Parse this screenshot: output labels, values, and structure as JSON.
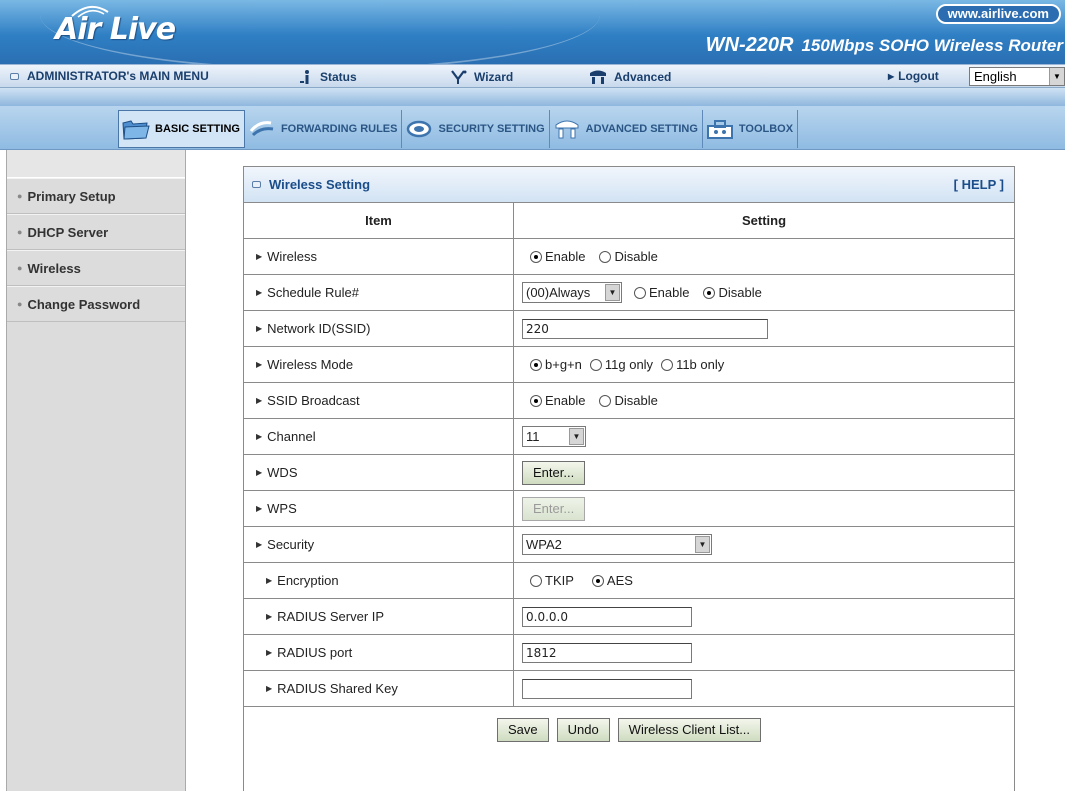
{
  "header": {
    "logo": "Air Live",
    "url": "www.airlive.com",
    "model": "WN-220R",
    "model_desc": "150Mbps SOHO Wireless Router"
  },
  "menubar": {
    "main_menu": "ADMINISTRATOR's MAIN MENU",
    "status": "Status",
    "wizard": "Wizard",
    "advanced": "Advanced",
    "logout": "Logout",
    "language": "English"
  },
  "toolbar": {
    "tabs": [
      {
        "label": "BASIC SETTING",
        "icon": "folder-icon",
        "active": true
      },
      {
        "label": "FORWARDING RULES",
        "icon": "arrows-icon",
        "active": false
      },
      {
        "label": "SECURITY SETTING",
        "icon": "security-icon",
        "active": false
      },
      {
        "label": "ADVANCED SETTING",
        "icon": "gear-icon",
        "active": false
      },
      {
        "label": "TOOLBOX",
        "icon": "toolbox-icon",
        "active": false
      }
    ]
  },
  "sidebar": {
    "items": [
      {
        "label": "Primary Setup"
      },
      {
        "label": "DHCP Server"
      },
      {
        "label": "Wireless"
      },
      {
        "label": "Change Password"
      }
    ]
  },
  "panel": {
    "title": "Wireless Setting",
    "help": "[ HELP ]",
    "col_item": "Item",
    "col_setting": "Setting",
    "rows": {
      "wireless": {
        "label": "Wireless",
        "opt1": "Enable",
        "opt2": "Disable",
        "selected": "Enable"
      },
      "schedule": {
        "label": "Schedule Rule#",
        "select": "(00)Always",
        "opt1": "Enable",
        "opt2": "Disable",
        "selected": "Disable"
      },
      "ssid": {
        "label": "Network ID(SSID)",
        "value": "220"
      },
      "mode": {
        "label": "Wireless Mode",
        "opt1": "b+g+n",
        "opt2": "11g only",
        "opt3": "11b only",
        "selected": "b+g+n"
      },
      "broadcast": {
        "label": "SSID Broadcast",
        "opt1": "Enable",
        "opt2": "Disable",
        "selected": "Enable"
      },
      "channel": {
        "label": "Channel",
        "value": "11"
      },
      "wds": {
        "label": "WDS",
        "button": "Enter..."
      },
      "wps": {
        "label": "WPS",
        "button": "Enter..."
      },
      "security": {
        "label": "Security",
        "value": "WPA2"
      },
      "encryption": {
        "label": "Encryption",
        "opt1": "TKIP",
        "opt2": "AES",
        "selected": "AES"
      },
      "radius_ip": {
        "label": "RADIUS Server IP",
        "value": "0.0.0.0"
      },
      "radius_port": {
        "label": "RADIUS port",
        "value": "1812"
      },
      "radius_key": {
        "label": "RADIUS Shared Key",
        "value": ""
      }
    },
    "buttons": {
      "save": "Save",
      "undo": "Undo",
      "client_list": "Wireless Client List..."
    }
  }
}
